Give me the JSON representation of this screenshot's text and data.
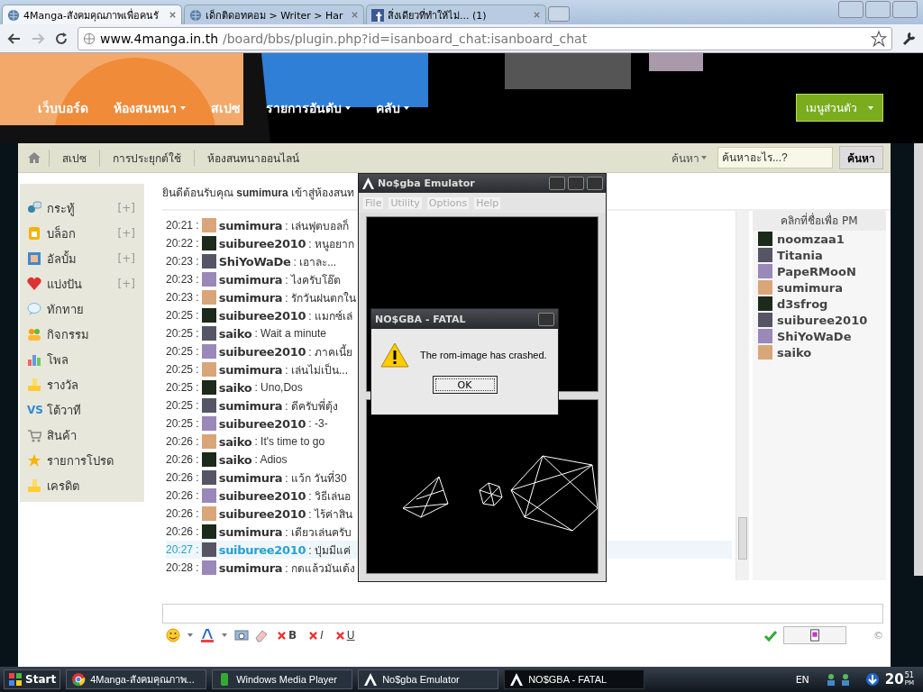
{
  "browser": {
    "tabs": [
      {
        "label": "4Manga-สังคมคุณภาพเพื่อคนรั",
        "kind": "globe",
        "selected": true
      },
      {
        "label": "เด็กติดอทคอม > Writer > Har",
        "kind": "globe",
        "selected": false
      },
      {
        "label": "สิ่งเดียวที่ทำให้ไม่... (1)",
        "kind": "facebook",
        "selected": false
      }
    ],
    "url_host": "www.4manga.in.th",
    "url_path": "/board/bbs/plugin.php?id=isanboard_chat:isanboard_chat"
  },
  "nav": {
    "items": [
      {
        "label": "เว็บบอร์ด",
        "dropdown": false
      },
      {
        "label": "ห้องสนทนา",
        "dropdown": true
      },
      {
        "label": "สเปซ",
        "dropdown": false
      },
      {
        "label": "รายการอันดับ",
        "dropdown": true
      },
      {
        "label": "คลับ",
        "dropdown": true
      }
    ],
    "menu_button": "เมนูส่วนตัว"
  },
  "breadcrumb": [
    "สเปซ",
    "การประยุกต์ใช้",
    "ห้องสนทนาออนไลน์"
  ],
  "search": {
    "scope": "ค้นหา",
    "placeholder": "ค้นหาอะไร...?",
    "button": "ค้นหา"
  },
  "sidebar": [
    {
      "label": "กระทู้",
      "kind": "chat",
      "add": "[+]"
    },
    {
      "label": "บล็อก",
      "kind": "blog",
      "add": "[+]"
    },
    {
      "label": "อัลบั้ม",
      "kind": "album",
      "add": "[+]"
    },
    {
      "label": "แบ่งปัน",
      "kind": "share",
      "add": "[+]"
    },
    {
      "label": "ทักทาย",
      "kind": "greet"
    },
    {
      "label": "กิจกรรม",
      "kind": "people"
    },
    {
      "label": "โพล",
      "kind": "poll"
    },
    {
      "label": "รางวัล",
      "kind": "coins"
    },
    {
      "label": "โต้วาที",
      "kind": "vs",
      "icon_text": "VS"
    },
    {
      "label": "สินค้า",
      "kind": "cart"
    },
    {
      "label": "รายการโปรด",
      "kind": "star"
    },
    {
      "label": "เครดิต",
      "kind": "coins"
    }
  ],
  "welcome": "ยินดีต้อนรับคุณ **sumimura** เข้าสู่ห้องสนท",
  "chat": [
    {
      "time": "20:21 :",
      "user": "sumimura",
      "message": ": เล่นฟุตบอลก็",
      "highlighted": false
    },
    {
      "time": "20:22 :",
      "user": "suiburee2010",
      "message": ": หนูอยาก",
      "highlighted": false
    },
    {
      "time": "20:23 :",
      "user": "ShiYoWaDe",
      "message": ": เอาละ...",
      "highlighted": false
    },
    {
      "time": "20:23 :",
      "user": "sumimura",
      "message": ": ไงครับโอ๊ต",
      "highlighted": false
    },
    {
      "time": "20:23 :",
      "user": "sumimura",
      "message": ": รักวันฝนตกใน",
      "highlighted": false
    },
    {
      "time": "20:25 :",
      "user": "suiburee2010",
      "message": ": แมกซ์เล่",
      "highlighted": false
    },
    {
      "time": "20:25 :",
      "user": "saiko",
      "message": ": Wait a minute",
      "highlighted": false
    },
    {
      "time": "20:25 :",
      "user": "suiburee2010",
      "message": ": ภาคเนี้ย",
      "highlighted": false
    },
    {
      "time": "20:25 :",
      "user": "sumimura",
      "message": ": เล่นไม่เป็น...",
      "highlighted": false
    },
    {
      "time": "20:25 :",
      "user": "saiko",
      "message": ": Uno,Dos",
      "highlighted": false
    },
    {
      "time": "20:25 :",
      "user": "sumimura",
      "message": ": ดีครับพี่ตุ้ง",
      "highlighted": false
    },
    {
      "time": "20:25 :",
      "user": "suiburee2010",
      "message": ": -3-",
      "highlighted": false
    },
    {
      "time": "20:26 :",
      "user": "saiko",
      "message": ": It's time to go",
      "highlighted": false
    },
    {
      "time": "20:26 :",
      "user": "saiko",
      "message": ": Adios",
      "highlighted": false
    },
    {
      "time": "20:26 :",
      "user": "sumimura",
      "message": ": แว้ก วันที่30",
      "highlighted": false
    },
    {
      "time": "20:26 :",
      "user": "suiburee2010",
      "message": ": วิธีเล่นอ",
      "highlighted": false
    },
    {
      "time": "20:26 :",
      "user": "suiburee2010",
      "message": ": ไร้ค่าสิน",
      "highlighted": false
    },
    {
      "time": "20:26 :",
      "user": "sumimura",
      "message": ": เดียวเล่นครับ",
      "highlighted": false
    },
    {
      "time": "20:27 :",
      "user": "suiburee2010",
      "message": ": ปุ่มมีแค่",
      "highlighted": true
    },
    {
      "time": "20:28 :",
      "user": "sumimura",
      "message": ": กดแล้วมันเด้ง",
      "highlighted": false
    }
  ],
  "online": {
    "heading": "คลิกที่ชื่อเพื่อ PM",
    "users": [
      "noomzaa1",
      "Titania",
      "PapeRMooN",
      "sumimura",
      "d3sfrog",
      "suiburee2010",
      "ShiYoWaDe",
      "saiko"
    ]
  },
  "toolbar": {
    "format_letters": [
      "B",
      "I",
      "U"
    ],
    "copyright": "©"
  },
  "emulator": {
    "title": "No$gba Emulator",
    "menu": [
      {
        "label": "File",
        "disabled": true
      },
      {
        "label": "Utility",
        "disabled": true
      },
      {
        "label": "Options",
        "disabled": true
      },
      {
        "label": "Help",
        "disabled": true
      }
    ]
  },
  "dialog": {
    "title": "NO$GBA - FATAL",
    "message": "The rom-image has crashed.",
    "button": "OK"
  },
  "taskbar": {
    "start": "Start",
    "items": [
      {
        "label": "4Manga-สังคมคุณภาพ...",
        "kind": "chrome",
        "selected": false
      },
      {
        "label": "Windows Media Player",
        "kind": "media",
        "selected": false
      },
      {
        "label": "No$gba Emulator",
        "kind": "nosgba",
        "selected": false
      },
      {
        "label": "NO$GBA - FATAL",
        "kind": "nosgba",
        "selected": true
      }
    ],
    "language": "EN",
    "clock_hour": "20",
    "clock_minute": "51",
    "clock_ampm": "PM"
  }
}
